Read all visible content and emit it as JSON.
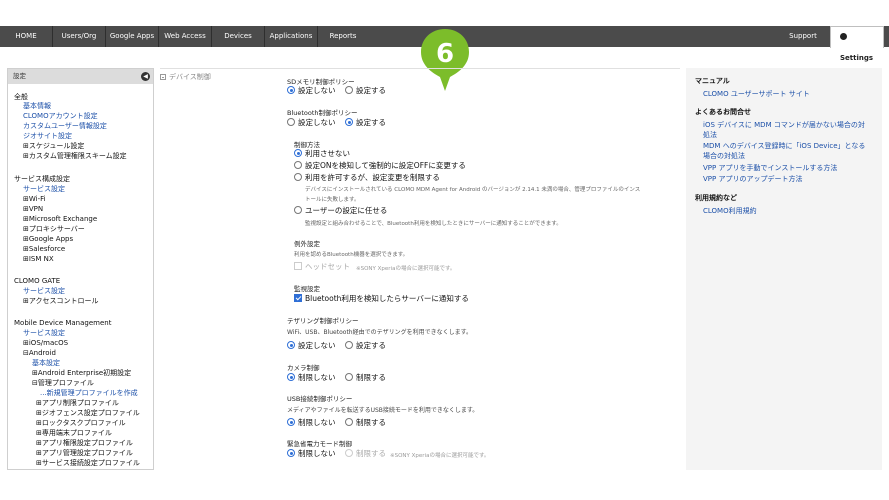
{
  "nav": {
    "items": [
      "HOME",
      "Users/Org",
      "Google Apps",
      "Web Access",
      "Devices",
      "Applications",
      "Reports"
    ],
    "support": "Support",
    "settings": "Settings"
  },
  "marker": {
    "number": "6",
    "color": "#7cbd2a"
  },
  "sidebar": {
    "header": "設定",
    "g1_title": "全般",
    "g1_items": [
      "基本情報",
      "CLOMOアカウント設定",
      "カスタムユーザー情報設定",
      "ジオサイト設定"
    ],
    "g1_tree": [
      "⊞スケジュール設定",
      "⊞カスタム管理権限スキーム設定"
    ],
    "g2_title": "サービス構成設定",
    "g2_link": "サービス設定",
    "g2_tree": [
      "⊞Wi-Fi",
      "⊞VPN",
      "⊞Microsoft Exchange",
      "⊞プロキシサーバー",
      "⊞Google Apps",
      "⊞Salesforce",
      "⊞ISM NX"
    ],
    "g3_title": "CLOMO GATE",
    "g3_link": "サービス設定",
    "g3_tree": [
      "⊞アクセスコントロール"
    ],
    "g4_title": "Mobile Device Management",
    "g4_link": "サービス設定",
    "g4_tree": [
      "⊞iOS/macOS",
      "⊟Android"
    ],
    "g4_basic": "基本設定",
    "g4_ae": "⊞Android Enterprise初期設定",
    "g4_profile": "⊟管理プロファイル",
    "g4_new": "...新規管理プロファイルを作成",
    "g4_sub": [
      "⊞アプリ制限プロファイル",
      "⊞ジオフェンス設定プロファイル",
      "⊞ロックタスクプロファイル",
      "⊞専用端末プロファイル",
      "⊞アプリ権限設定プロファイル",
      "⊞アプリ管理設定プロファイル",
      "⊞サービス接続設定プロファイル"
    ]
  },
  "main": {
    "section": "デバイス制御",
    "sd": {
      "title": "SDメモリ制御ポリシー",
      "opt1": "設定しない",
      "opt2": "設定する"
    },
    "bt": {
      "title": "Bluetooth制御ポリシー",
      "opt1": "設定しない",
      "opt2": "設定する"
    },
    "method": {
      "title": "制御方法",
      "o1": "利用させない",
      "o2": "設定ONを検知して強制的に設定OFFに変更する",
      "o3": "利用を許可するが、設定変更を制限する",
      "o3_desc1": "デバイスにインストールされている CLOMO MDM Agent for Android のバージョンが 2.14.1 未満の場合、管理プロファイルのインス",
      "o3_desc2": "トールに失敗します。",
      "o4": "ユーザーの設定に任せる",
      "o4_desc": "監視設定と組み合わせることで、Bluetooth利用を検知したときにサーバーに通知することができます。"
    },
    "exception": {
      "title": "例外設定",
      "desc": "利用を認めるBluetooth機器を選択できます。",
      "headset": "ヘッドセット",
      "note": "※SONY Xperiaの場合に選択可能です。"
    },
    "monitor": {
      "title": "監視設定",
      "label": "Bluetooth利用を検知したらサーバーに通知する"
    },
    "tether": {
      "title": "テザリング制御ポリシー",
      "desc": "WiFi、USB、Bluetooth経由でのテザリングを利用できなくします。",
      "opt1": "設定しない",
      "opt2": "設定する"
    },
    "camera": {
      "title": "カメラ制御",
      "opt1": "制限しない",
      "opt2": "制限する"
    },
    "usb": {
      "title": "USB接続制御ポリシー",
      "desc": "メディアやファイルを転送するUSB接続モードを利用できなくします。",
      "opt1": "制限しない",
      "opt2": "制限する"
    },
    "emergency": {
      "title": "緊急省電力モード制御",
      "opt1": "制限しない",
      "opt2": "制限する",
      "note": "※SONY Xperiaの場合に選択可能です。"
    }
  },
  "right": {
    "manual_title": "マニュアル",
    "manual_link": "CLOMO ユーザーサポート サイト",
    "faq_title": "よくあるお問合せ",
    "faq1a": "iOS デバイスに MDM コマンドが届かない場合の対",
    "faq1b": "処法",
    "faq2a": "MDM へのデバイス登録時に「iOS Device」となる",
    "faq2b": "場合の対処法",
    "faq3": "VPP アプリを手動でインストールする方法",
    "faq4": "VPP アプリのアップデート方法",
    "terms_title": "利用規約など",
    "terms_link": "CLOMO利用規約"
  },
  "colors": {
    "accent": "#2f6fd6",
    "link": "#1b4fa8",
    "navbar": "#4b4b4b",
    "marker": "#7cbd2a"
  }
}
